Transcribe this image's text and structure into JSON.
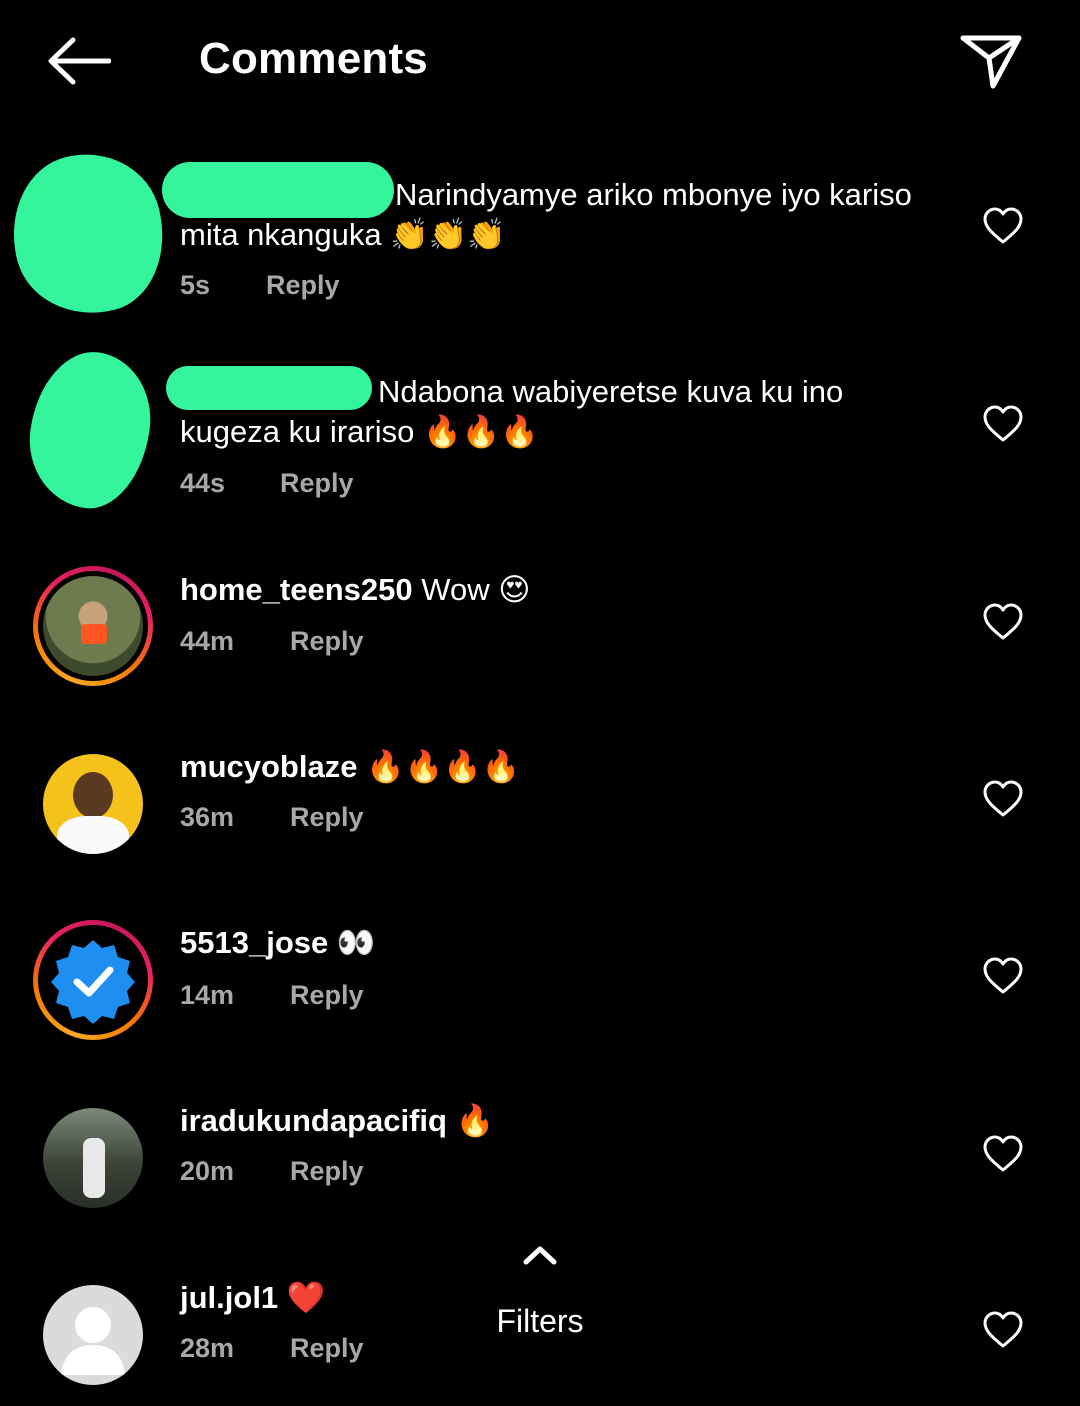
{
  "header": {
    "title": "Comments",
    "back_icon": "arrow-left-icon",
    "send_icon": "paper-plane-icon"
  },
  "comments": [
    {
      "username": "",
      "text": "Narindyamye ariko mbonye iyo kariso mita nkanguka 👏👏👏",
      "time": "5s",
      "reply": "Reply",
      "redacted": true
    },
    {
      "username": "",
      "text": "Ndabona wabiyeretse kuva ku ino kugeza ku irariso 🔥🔥🔥",
      "time": "44s",
      "reply": "Reply",
      "redacted": true
    },
    {
      "username": "home_teens250",
      "text": "Wow 😍",
      "time": "44m",
      "reply": "Reply",
      "story_ring": true
    },
    {
      "username": "mucyoblaze",
      "text": "🔥🔥🔥🔥",
      "time": "36m",
      "reply": "Reply"
    },
    {
      "username": "5513_jose",
      "text": "👀",
      "time": "14m",
      "reply": "Reply",
      "story_ring": true
    },
    {
      "username": "iradukundapacifiq",
      "text": "🔥",
      "time": "20m",
      "reply": "Reply"
    },
    {
      "username": "jul.jol1",
      "text": "❤️",
      "time": "28m",
      "reply": "Reply"
    }
  ],
  "filters": {
    "label": "Filters",
    "icon": "chevron-up-icon"
  },
  "colors": {
    "background": "#000000",
    "meta_text": "#a8a8a8",
    "redaction": "#34f59b",
    "verified_blue": "#1f8ef1"
  }
}
